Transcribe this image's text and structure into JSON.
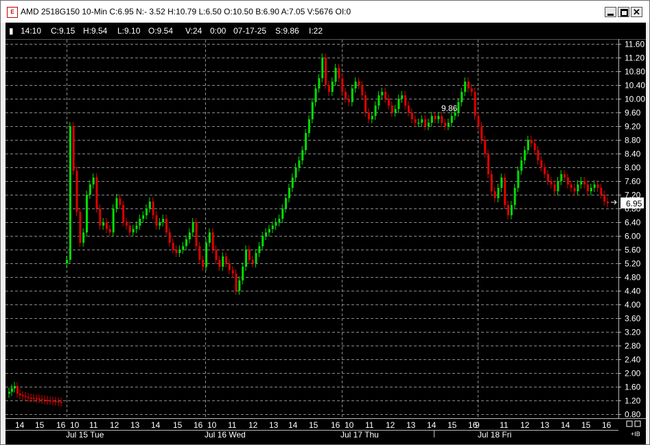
{
  "window": {
    "title": "AMD 2518G150 10-Min C:6.95 N:- 3.52 H:10.79 L:6.50 O:10.50 B:6.90 A:7.05 V:5676 OI:0",
    "icon_name": "app-logo-icon",
    "buttons": [
      "minimize-icon",
      "maximize-icon",
      "close-icon"
    ]
  },
  "info_bar": {
    "marker": "▮",
    "time": "14:10",
    "close": "C:9.15",
    "high": "H:9.54",
    "low": "L:9.10",
    "open": "O:9.54",
    "volume": "V:24",
    "oi": "0:00",
    "date": "07-17-25",
    "settle": "S:9.86",
    "interval": "I:22"
  },
  "colors": {
    "background": "#000000",
    "up": "#00e000",
    "down": "#e00000",
    "grid": "#8a8a8a",
    "text": "#ffffff"
  },
  "chart_data": {
    "type": "candlestick",
    "title": "AMD 2518G150 10-Min",
    "ylim": [
      0.8,
      11.8
    ],
    "y_ticks": [
      "11.60",
      "11.20",
      "10.80",
      "10.40",
      "10.00",
      "9.60",
      "9.20",
      "8.80",
      "8.40",
      "8.00",
      "7.60",
      "7.20",
      "6.80",
      "6.40",
      "6.00",
      "5.60",
      "5.20",
      "4.80",
      "4.40",
      "4.00",
      "3.60",
      "3.20",
      "2.80",
      "2.40",
      "2.00",
      "1.60",
      "1.20",
      "0.80"
    ],
    "x_hour_labels": [
      "14",
      "15",
      "16",
      "10",
      "11",
      "12",
      "13",
      "14",
      "15",
      "16",
      "10",
      "11",
      "12",
      "13",
      "14",
      "15",
      "16",
      "10",
      "11",
      "12",
      "13",
      "14",
      "15",
      "16",
      "9",
      "11",
      "12",
      "13",
      "14",
      "15",
      "16"
    ],
    "day_labels": [
      "Jul 15 Tue",
      "Jul 16 Wed",
      "Jul 17 Thu",
      "Jul 18 Fri"
    ],
    "last_price_label": "6.95",
    "settle_label": "9.86",
    "corner_label": "+IB",
    "prev_day_closes": [
      1.45,
      1.55,
      1.62,
      1.4,
      1.35,
      1.33,
      1.3,
      1.28,
      1.27,
      1.26,
      1.25,
      1.24,
      1.22,
      1.21,
      1.2,
      1.19,
      1.18,
      1.17,
      1.16,
      1.15
    ],
    "closes": [
      5.3,
      9.2,
      7.9,
      6.7,
      5.8,
      6.1,
      7.2,
      7.5,
      7.7,
      6.8,
      6.3,
      6.4,
      6.2,
      6.1,
      6.8,
      7.1,
      6.9,
      6.4,
      6.3,
      6.1,
      6.2,
      6.3,
      6.5,
      6.6,
      6.8,
      7.0,
      6.6,
      6.3,
      6.4,
      6.5,
      6.1,
      5.8,
      5.6,
      5.5,
      5.6,
      5.7,
      5.9,
      6.1,
      6.4,
      5.7,
      5.3,
      5.1,
      5.8,
      6.1,
      5.6,
      5.3,
      5.1,
      5.4,
      5.2,
      5.0,
      4.9,
      4.4,
      4.7,
      5.1,
      5.6,
      5.3,
      5.2,
      5.5,
      5.7,
      6.0,
      6.1,
      6.2,
      6.3,
      6.4,
      6.5,
      6.8,
      7.1,
      7.4,
      7.7,
      8.0,
      8.2,
      8.5,
      9.0,
      9.4,
      9.9,
      10.3,
      10.6,
      11.2,
      10.4,
      10.2,
      10.5,
      10.9,
      10.6,
      10.2,
      10.0,
      9.9,
      10.3,
      10.5,
      10.4,
      10.1,
      9.6,
      9.4,
      9.5,
      9.8,
      10.1,
      10.2,
      10.0,
      9.8,
      9.6,
      9.7,
      10.0,
      10.1,
      9.8,
      9.6,
      9.4,
      9.3,
      9.3,
      9.4,
      9.2,
      9.3,
      9.5,
      9.4,
      9.5,
      9.3,
      9.2,
      9.3,
      9.5,
      9.6,
      9.9,
      10.2,
      10.5,
      10.3,
      10.2,
      9.5,
      9.2,
      8.8,
      8.4,
      7.8,
      7.3,
      7.1,
      7.4,
      7.7,
      6.9,
      6.6,
      6.9,
      7.4,
      7.9,
      8.2,
      8.5,
      8.8,
      8.7,
      8.5,
      8.2,
      8.0,
      7.8,
      7.6,
      7.5,
      7.3,
      7.6,
      7.8,
      7.7,
      7.5,
      7.4,
      7.3,
      7.5,
      7.6,
      7.5,
      7.3,
      7.4,
      7.5,
      7.4,
      7.2,
      7.0,
      6.95
    ]
  }
}
